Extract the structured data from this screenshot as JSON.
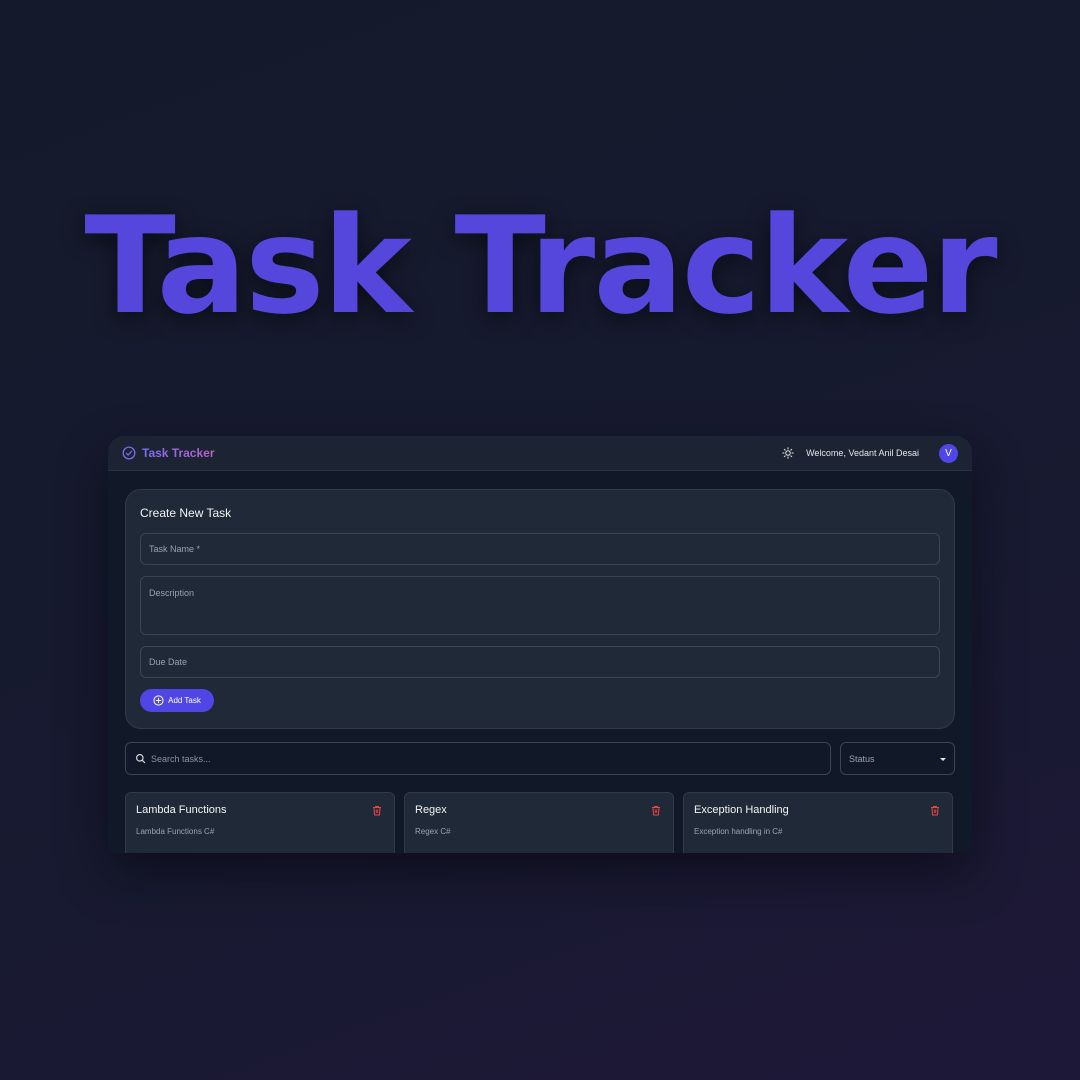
{
  "hero": {
    "title": "Task Tracker"
  },
  "navbar": {
    "brand": "Task Tracker",
    "welcome": "Welcome, Vedant Anil Desai",
    "avatar_initial": "V",
    "icons": {
      "brand": "check-circle-icon",
      "theme": "sun-icon"
    }
  },
  "create_form": {
    "heading": "Create New Task",
    "task_name_placeholder": "Task Name *",
    "description_placeholder": "Description",
    "due_date_placeholder": "Due Date",
    "add_button": "Add Task"
  },
  "filters": {
    "search_placeholder": "Search tasks...",
    "status_label": "Status"
  },
  "tasks": [
    {
      "title": "Lambda Functions",
      "description": "Lambda Functions C#"
    },
    {
      "title": "Regex",
      "description": "Regex C#"
    },
    {
      "title": "Exception Handling",
      "description": "Exception handling in C#"
    }
  ],
  "colors": {
    "accent": "#4f46e5",
    "hero": "#5547dc",
    "danger": "#ef4444",
    "card": "#1f2937",
    "surface": "#111827"
  }
}
